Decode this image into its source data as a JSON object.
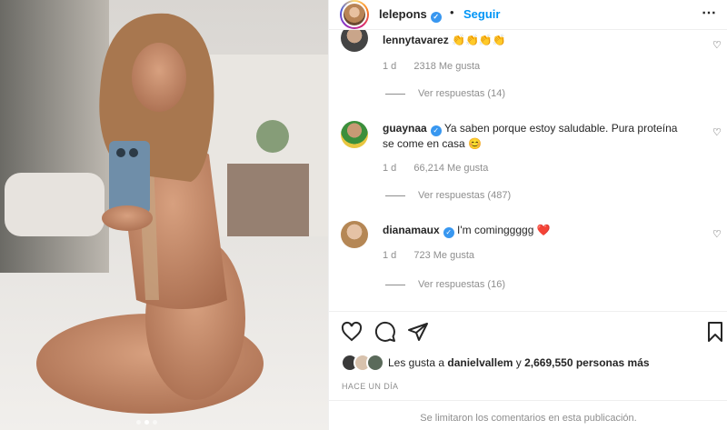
{
  "header": {
    "username": "lelepons",
    "follow_label": "Seguir",
    "separator": "•"
  },
  "comments": [
    {
      "username": "lennytavarez",
      "text": "👏👏👏👏",
      "age": "1 d",
      "likes": "2318 Me gusta",
      "replies": "Ver respuestas (14)",
      "verified": false
    },
    {
      "username": "guaynaa",
      "text": "Ya saben porque estoy saludable. Pura proteína se come en casa 😊",
      "age": "1 d",
      "likes": "66,214 Me gusta",
      "replies": "Ver respuestas (487)",
      "verified": true
    },
    {
      "username": "dianamaux",
      "text": "I'm cominggggg ❤️",
      "age": "1 d",
      "likes": "723 Me gusta",
      "replies": "Ver respuestas (16)",
      "verified": true
    }
  ],
  "actions": {
    "like_icon": "heart-outline",
    "comment_icon": "speech-bubble",
    "share_icon": "paper-plane",
    "save_icon": "bookmark"
  },
  "likes": {
    "prefix": "Les gusta a",
    "user": "danielvallem",
    "middle": "y",
    "count_text": "2,669,550 personas más"
  },
  "time_ago": "HACE UN DÍA",
  "footer_notice": "Se limitaron los comentarios en esta publicación.",
  "carousel": {
    "total": 3,
    "active_index": 1
  },
  "colors": {
    "accent": "#0095f6",
    "verified": "#3897f0",
    "muted": "#8e8e8e",
    "like_heart": "#e0245e"
  }
}
